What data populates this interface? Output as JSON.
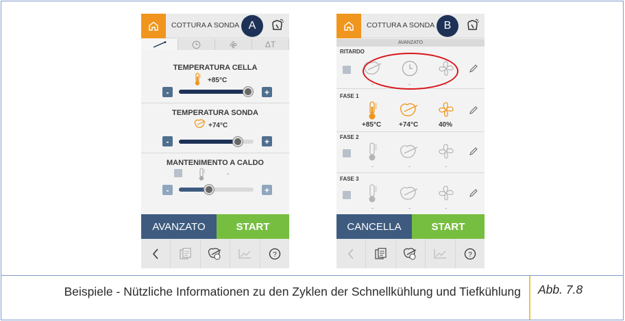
{
  "figure": {
    "caption": "Beispiele - Nützliche Informationen zu den Zyklen der Schnellkühlung und Tiefkühlung",
    "reference": "Abb. 7.8"
  },
  "screen_a": {
    "badge": "A",
    "title": "COTTURA A SONDA",
    "tabs": [
      "probe-icon",
      "clock-icon",
      "fan-icon",
      "delta-t-icon"
    ],
    "tab_dt": "ΔT",
    "settings": [
      {
        "title": "TEMPERATURA CELLA",
        "value": "+85°C",
        "icon": "thermometer-icon",
        "level": 0.92
      },
      {
        "title": "TEMPERATURA SONDA",
        "value": "+74°C",
        "icon": "probe-food-icon",
        "level": 0.77
      },
      {
        "title": "MANTENIMENTO A CALDO",
        "value": "-",
        "icon": "thermometer-icon",
        "level": 0.3
      }
    ],
    "minus": "-",
    "plus": "+",
    "button_left": "AVANZATO",
    "button_right": "START",
    "nav": [
      "back-icon",
      "recipe-book-icon",
      "probe-cooking-icon",
      "graph-icon",
      "help-icon"
    ],
    "help_symbol": "?"
  },
  "screen_b": {
    "badge": "B",
    "title": "COTTURA A SONDA",
    "subtitle": "AVANZATO",
    "phases": [
      {
        "label": "RITARDO",
        "values": [
          "-",
          "-",
          "-"
        ],
        "active": false
      },
      {
        "label": "FASE 1",
        "values": [
          "+85°C",
          "+74°C",
          "40%"
        ],
        "active": true
      },
      {
        "label": "FASE 2",
        "values": [
          "-",
          "-",
          "-"
        ],
        "active": false
      },
      {
        "label": "FASE 3",
        "values": [
          "-",
          "-",
          "-"
        ],
        "active": false
      }
    ],
    "button_left": "CANCELLA",
    "button_right": "START",
    "nav": [
      "back-icon",
      "recipe-book-icon",
      "probe-cooking-icon",
      "graph-icon",
      "help-icon"
    ],
    "help_symbol": "?"
  },
  "colors": {
    "orange": "#f0961e",
    "navy": "#1e3257",
    "blue_button": "#3e5b7f",
    "green_button": "#76be40",
    "highlight": "#d9141b",
    "caption_bar": "#f0c830",
    "frame": "#7d9bc9"
  }
}
